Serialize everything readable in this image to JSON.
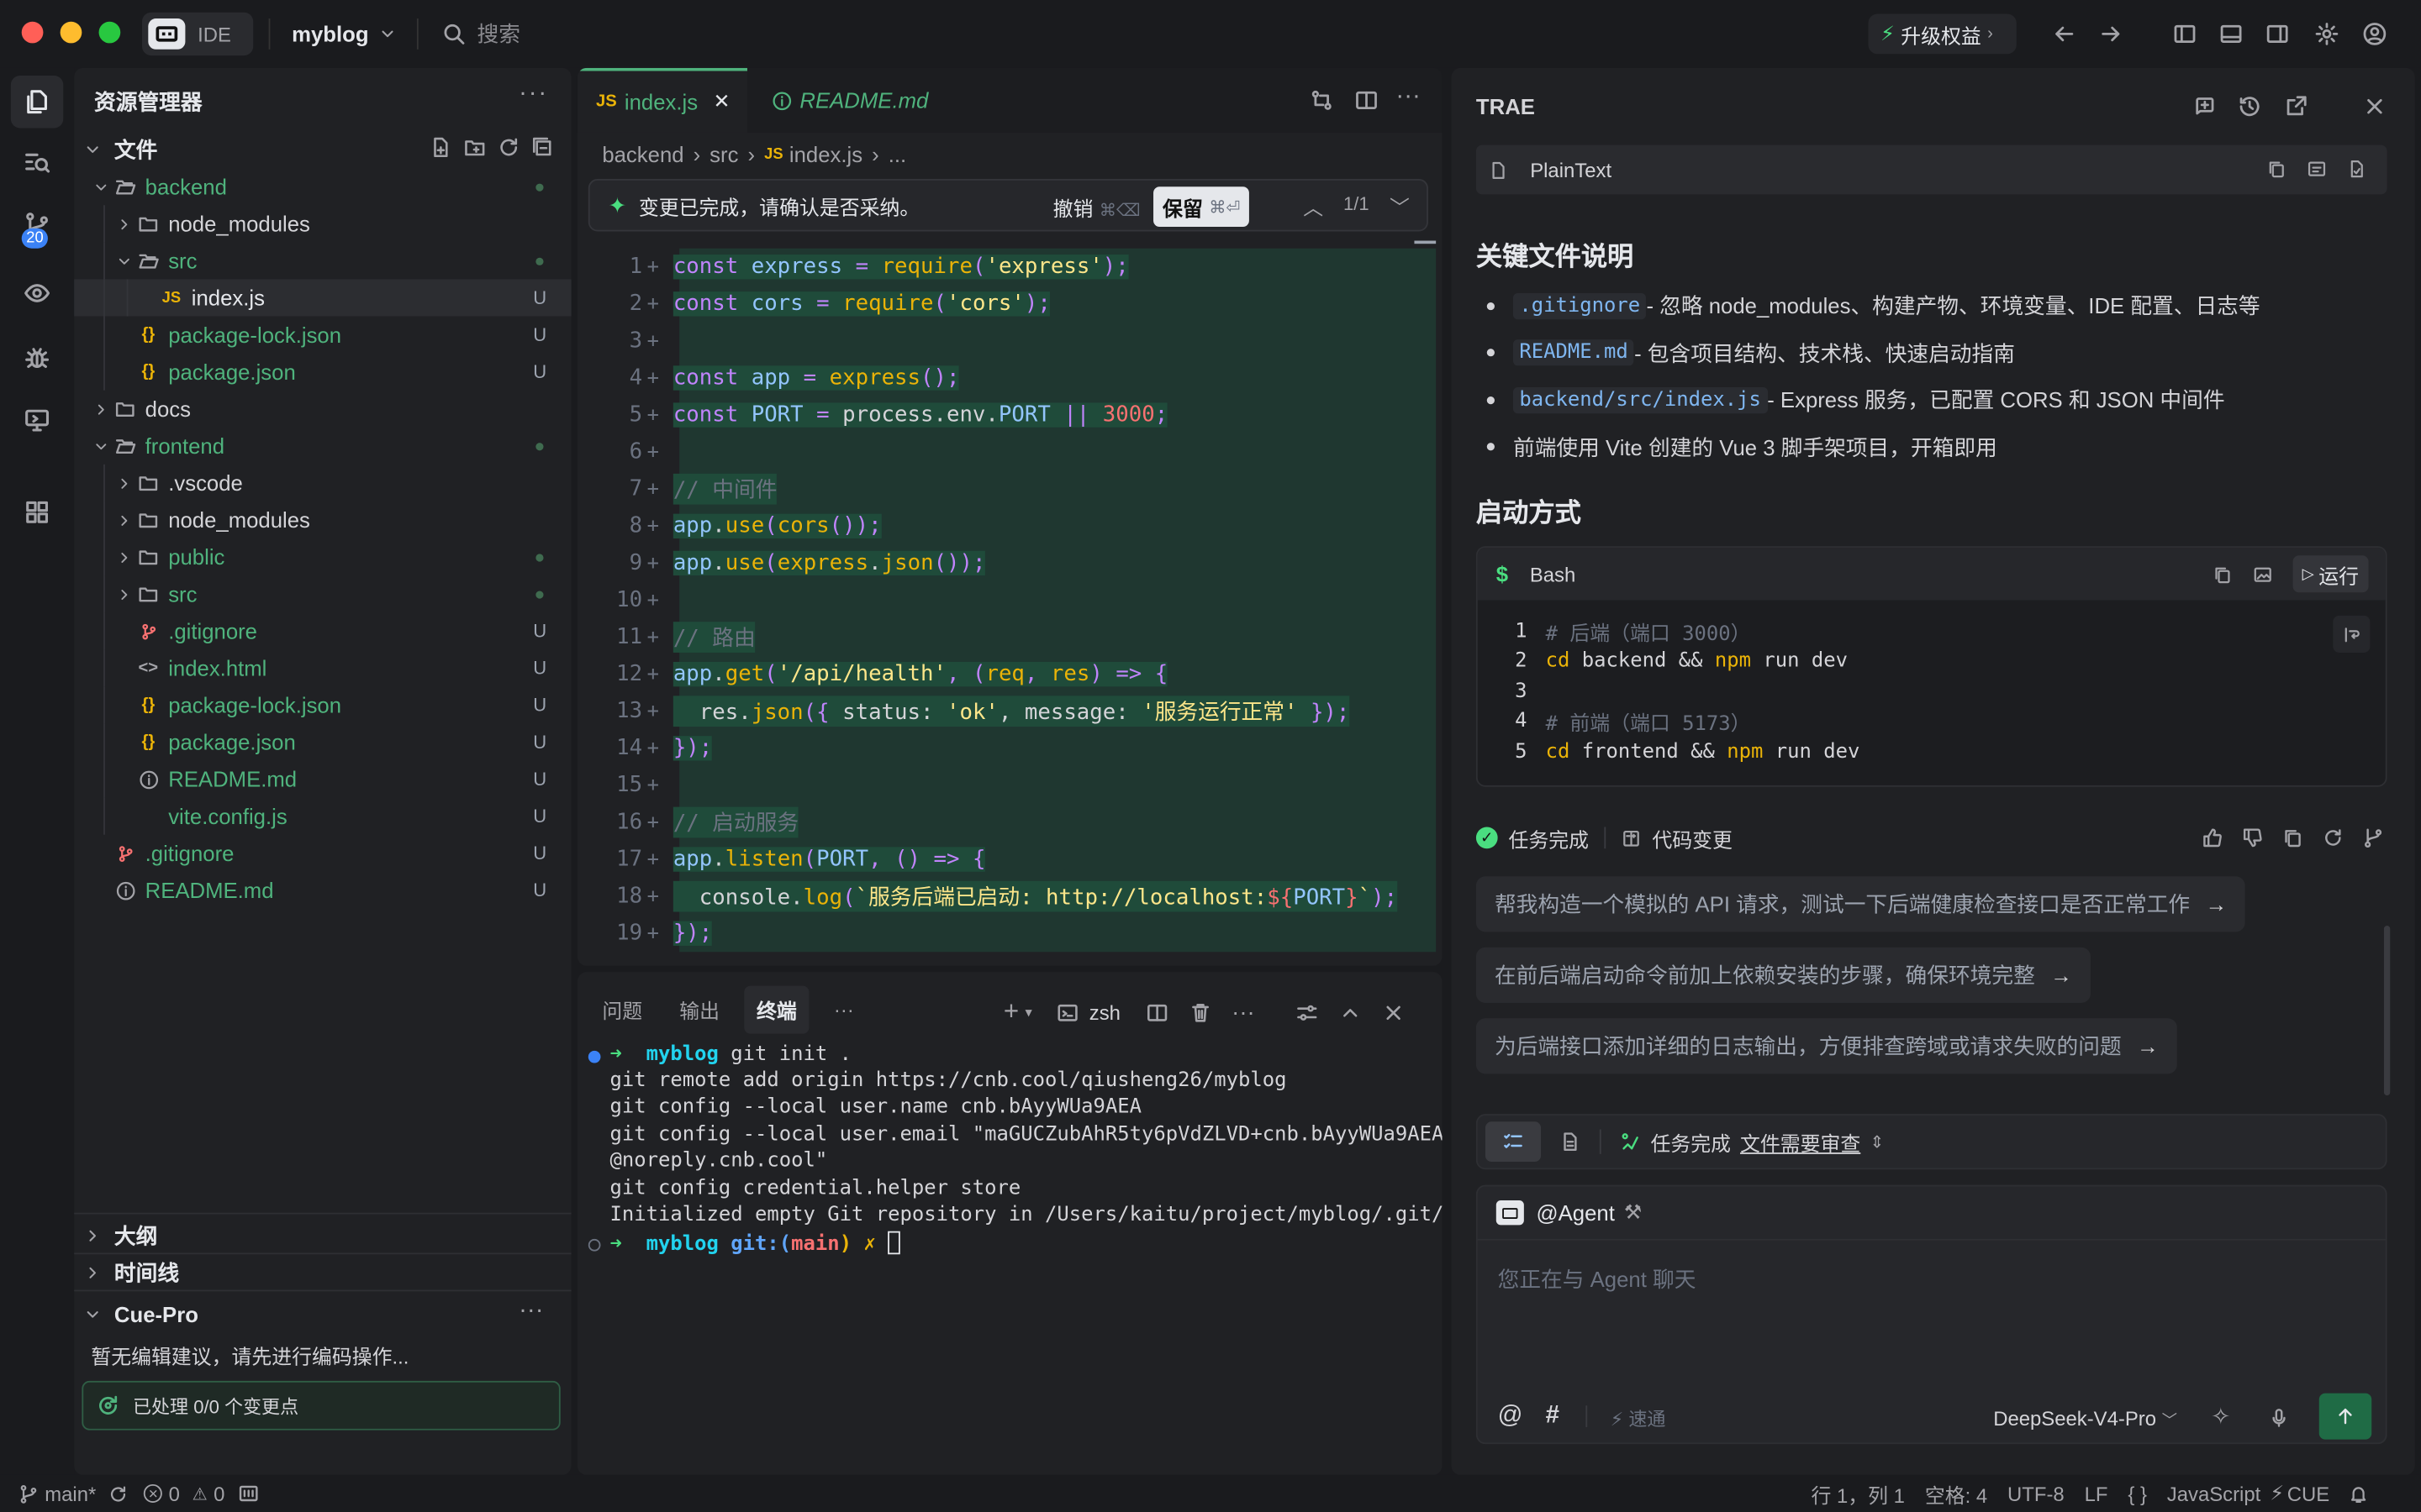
{
  "titlebar": {
    "ide_label": "IDE",
    "project": "myblog",
    "search_placeholder": "搜索",
    "upgrade": "升级权益"
  },
  "activity": {
    "badge": "20"
  },
  "explorer": {
    "title": "资源管理器",
    "section_files": "文件",
    "items": [
      {
        "name": "backend",
        "indent": 0,
        "kind": "folder-open",
        "status": "dot",
        "color": "green"
      },
      {
        "name": "node_modules",
        "indent": 1,
        "kind": "folder",
        "status": "",
        "color": "normal"
      },
      {
        "name": "src",
        "indent": 1,
        "kind": "folder-open",
        "status": "dot",
        "color": "green"
      },
      {
        "name": "index.js",
        "indent": 2,
        "kind": "js",
        "status": "U",
        "color": "white"
      },
      {
        "name": "package-lock.json",
        "indent": 1,
        "kind": "json",
        "status": "U",
        "color": "green"
      },
      {
        "name": "package.json",
        "indent": 1,
        "kind": "json",
        "status": "U",
        "color": "green"
      },
      {
        "name": "docs",
        "indent": 0,
        "kind": "folder",
        "status": "",
        "color": "normal"
      },
      {
        "name": "frontend",
        "indent": 0,
        "kind": "folder-open",
        "status": "dot",
        "color": "green"
      },
      {
        "name": ".vscode",
        "indent": 1,
        "kind": "folder",
        "status": "",
        "color": "normal"
      },
      {
        "name": "node_modules",
        "indent": 1,
        "kind": "folder",
        "status": "",
        "color": "normal"
      },
      {
        "name": "public",
        "indent": 1,
        "kind": "folder",
        "status": "dot",
        "color": "green"
      },
      {
        "name": "src",
        "indent": 1,
        "kind": "folder",
        "status": "dot",
        "color": "green"
      },
      {
        "name": ".gitignore",
        "indent": 1,
        "kind": "git",
        "status": "U",
        "color": "green"
      },
      {
        "name": "index.html",
        "indent": 1,
        "kind": "html",
        "status": "U",
        "color": "green"
      },
      {
        "name": "package-lock.json",
        "indent": 1,
        "kind": "json",
        "status": "U",
        "color": "green"
      },
      {
        "name": "package.json",
        "indent": 1,
        "kind": "json",
        "status": "U",
        "color": "green"
      },
      {
        "name": "README.md",
        "indent": 1,
        "kind": "info",
        "status": "U",
        "color": "green"
      },
      {
        "name": "vite.config.js",
        "indent": 1,
        "kind": "none",
        "status": "U",
        "color": "green"
      },
      {
        "name": ".gitignore",
        "indent": 0,
        "kind": "git",
        "status": "U",
        "color": "green"
      },
      {
        "name": "README.md",
        "indent": 0,
        "kind": "info",
        "status": "U",
        "color": "green"
      }
    ],
    "outline": "大纲",
    "timeline": "时间线",
    "cuepro": "Cue-Pro",
    "cuepro_hint": "暂无编辑建议，请先进行编码操作...",
    "processed": "已处理 0/0 个变更点"
  },
  "editor": {
    "tab1": "index.js",
    "tab2": "README.md",
    "breadcrumb": [
      "backend",
      "src",
      "index.js",
      "..."
    ],
    "banner": "变更已完成，请确认是否采纳。",
    "reject": "撤销",
    "keep": "保留",
    "counter": "1/1",
    "code": [
      [
        [
          "kw",
          "const "
        ],
        [
          "var",
          "express"
        ],
        [
          "op",
          " = "
        ],
        [
          "fn",
          "require"
        ],
        [
          "op",
          "("
        ],
        [
          "str",
          "'express'"
        ],
        [
          "op",
          ");"
        ]
      ],
      [
        [
          "kw",
          "const "
        ],
        [
          "var",
          "cors"
        ],
        [
          "op",
          " = "
        ],
        [
          "fn",
          "require"
        ],
        [
          "op",
          "("
        ],
        [
          "str",
          "'cors'"
        ],
        [
          "op",
          ");"
        ]
      ],
      [],
      [
        [
          "kw",
          "const "
        ],
        [
          "var",
          "app"
        ],
        [
          "op",
          " = "
        ],
        [
          "fn",
          "express"
        ],
        [
          "op",
          "();"
        ]
      ],
      [
        [
          "kw",
          "const "
        ],
        [
          "var",
          "PORT"
        ],
        [
          "op",
          " = "
        ],
        [
          "txt",
          "process.env."
        ],
        [
          "var",
          "PORT"
        ],
        [
          "op",
          " || "
        ],
        [
          "num",
          "3000"
        ],
        [
          "op",
          ";"
        ]
      ],
      [],
      [
        [
          "cm",
          "// 中间件"
        ]
      ],
      [
        [
          "var",
          "app"
        ],
        [
          "txt",
          "."
        ],
        [
          "fn",
          "use"
        ],
        [
          "op",
          "("
        ],
        [
          "fn",
          "cors"
        ],
        [
          "op",
          "());"
        ]
      ],
      [
        [
          "var",
          "app"
        ],
        [
          "txt",
          "."
        ],
        [
          "fn",
          "use"
        ],
        [
          "op",
          "("
        ],
        [
          "fn",
          "express"
        ],
        [
          "txt",
          "."
        ],
        [
          "fn",
          "json"
        ],
        [
          "op",
          "());"
        ]
      ],
      [],
      [
        [
          "cm",
          "// 路由"
        ]
      ],
      [
        [
          "var",
          "app"
        ],
        [
          "txt",
          "."
        ],
        [
          "fn",
          "get"
        ],
        [
          "op",
          "("
        ],
        [
          "str",
          "'/api/health'"
        ],
        [
          "op",
          ", ("
        ],
        [
          "fn",
          "req"
        ],
        [
          "op",
          ", "
        ],
        [
          "fn",
          "res"
        ],
        [
          "op",
          ") => {"
        ]
      ],
      [
        [
          "txt",
          "  res."
        ],
        [
          "fn",
          "json"
        ],
        [
          "op",
          "({ "
        ],
        [
          "txt",
          "status: "
        ],
        [
          "str",
          "'ok'"
        ],
        [
          "txt",
          ", message: "
        ],
        [
          "str",
          "'服务运行正常'"
        ],
        [
          "op",
          " });"
        ]
      ],
      [
        [
          "op",
          "});"
        ]
      ],
      [],
      [
        [
          "cm",
          "// 启动服务"
        ]
      ],
      [
        [
          "var",
          "app"
        ],
        [
          "txt",
          "."
        ],
        [
          "fn",
          "listen"
        ],
        [
          "op",
          "("
        ],
        [
          "var",
          "PORT"
        ],
        [
          "op",
          ", () => {"
        ]
      ],
      [
        [
          "txt",
          "  console."
        ],
        [
          "fn",
          "log"
        ],
        [
          "op",
          "("
        ],
        [
          "str",
          "`服务后端已启动: http://localhost:"
        ],
        [
          "num",
          "${"
        ],
        [
          "var",
          "PORT"
        ],
        [
          "num",
          "}"
        ],
        [
          "str",
          "`"
        ],
        [
          "op",
          ");"
        ]
      ],
      [
        [
          "op",
          "});"
        ]
      ]
    ]
  },
  "panel": {
    "tabs": [
      "问题",
      "输出",
      "终端",
      "···"
    ],
    "shell": "zsh",
    "terminal": [
      "git remote add origin https://cnb.cool/qiusheng26/myblog",
      "git config --local user.name cnb.bAyyWUa9AEA",
      "git config --local user.email \"maGUCZubAhR5ty6pVdZLVD+cnb.bAyyWUa9AEA",
      "@noreply.cnb.cool\"",
      "git config credential.helper store",
      "Initialized empty Git repository in /Users/kaitu/project/myblog/.git/"
    ],
    "prompt1_dir": "myblog",
    "prompt1_cmd": " git init .",
    "prompt2_dir": "myblog",
    "prompt2_git": " git:(",
    "prompt2_branch": "main",
    "prompt2_end": ") ✗ "
  },
  "chat": {
    "title": "TRAE",
    "plaintext": "PlainText",
    "h_files": "关键文件说明",
    "bullets": [
      {
        "code": ".gitignore",
        "text": " - 忽略 node_modules、构建产物、环境变量、IDE 配置、日志等"
      },
      {
        "code": "README.md",
        "text": " - 包含项目结构、技术栈、快速启动指南"
      },
      {
        "code": "backend/src/index.js",
        "text": " - Express 服务，已配置 CORS 和 JSON 中间件"
      },
      {
        "code": "",
        "text": "前端使用 Vite 创建的 Vue 3 脚手架项目，开箱即用"
      }
    ],
    "h_start": "启动方式",
    "bash": "Bash",
    "run": "运行",
    "bash_lines": [
      {
        "n": "1",
        "parts": [
          [
            "cm",
            "# 后端（端口 3000）"
          ]
        ]
      },
      {
        "n": "2",
        "parts": [
          [
            "fn",
            "cd"
          ],
          [
            "txt",
            " backend && "
          ],
          [
            "fn",
            "npm"
          ],
          [
            "txt",
            " run dev"
          ]
        ]
      },
      {
        "n": "3",
        "parts": []
      },
      {
        "n": "4",
        "parts": [
          [
            "cm",
            "# 前端（端口 5173）"
          ]
        ]
      },
      {
        "n": "5",
        "parts": [
          [
            "fn",
            "cd"
          ],
          [
            "txt",
            " frontend && "
          ],
          [
            "fn",
            "npm"
          ],
          [
            "txt",
            " run dev"
          ]
        ]
      }
    ],
    "task_done": "任务完成",
    "code_change": "代码变更",
    "suggestions": [
      "帮我构造一个模拟的 API 请求，测试一下后端健康检查接口是否正常工作",
      "在前后端启动命令前加上依赖安装的步骤，确保环境完整",
      "为后端接口添加详细的日志输出，方便排查跨域或请求失败的问题"
    ],
    "status_done": "任务完成",
    "status_review": "文件需要审查",
    "agent": "@Agent",
    "input_placeholder": "您正在与 Agent 聊天",
    "speed": "速通",
    "model": "DeepSeek-V4-Pro"
  },
  "statusbar": {
    "branch": "main*",
    "errors": "0",
    "warnings": "0",
    "position": "行 1，列 1",
    "spaces": "空格: 4",
    "encoding": "UTF-8",
    "eol": "LF",
    "braces": "{ }",
    "language": "JavaScript",
    "cue": "CUE"
  },
  "colors": {
    "accent": "#4fb37d",
    "diff_bg": "#1f4b3a",
    "bg": "#1a1b1e",
    "panel": "#202124"
  }
}
